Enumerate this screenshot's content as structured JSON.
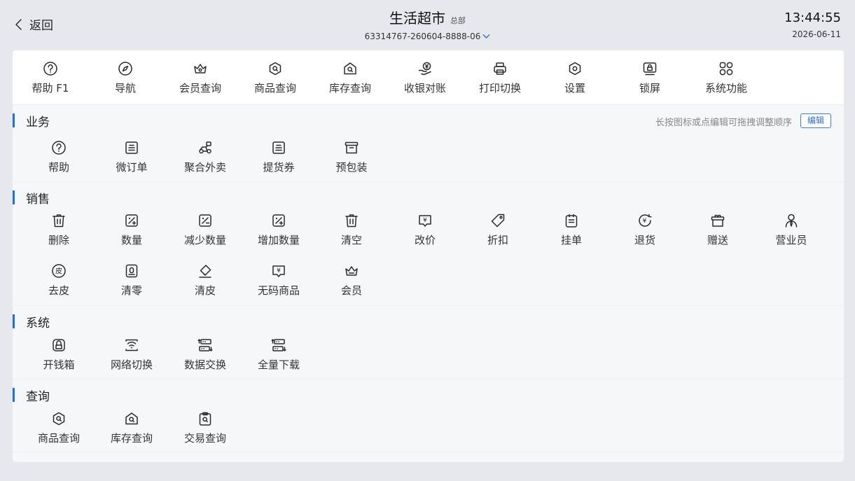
{
  "header": {
    "back_label": "返回",
    "store_name": "生活超市",
    "store_sub": "总部",
    "store_id": "63314767-260604-8888-06",
    "time": "13:44:55",
    "date": "2026-06-11"
  },
  "toolbar": {
    "items": [
      {
        "label": "帮助 F1",
        "icon": "help-icon"
      },
      {
        "label": "导航",
        "icon": "compass-icon"
      },
      {
        "label": "会员查询",
        "icon": "crown-icon"
      },
      {
        "label": "商品查询",
        "icon": "product-search-icon"
      },
      {
        "label": "库存查询",
        "icon": "inventory-search-icon"
      },
      {
        "label": "收银对账",
        "icon": "cash-reconcile-icon"
      },
      {
        "label": "打印切换",
        "icon": "printer-icon"
      },
      {
        "label": "设置",
        "icon": "settings-icon"
      },
      {
        "label": "锁屏",
        "icon": "lock-screen-icon"
      },
      {
        "label": "系统功能",
        "icon": "apps-grid-icon"
      }
    ]
  },
  "sections": {
    "business": {
      "title": "业务",
      "hint": "长按图标或点编辑可拖拽调整顺序",
      "edit_label": "编辑",
      "items": [
        {
          "label": "帮助",
          "icon": "help-icon"
        },
        {
          "label": "微订单",
          "icon": "order-icon"
        },
        {
          "label": "聚合外卖",
          "icon": "delivery-icon"
        },
        {
          "label": "提货券",
          "icon": "voucher-icon"
        },
        {
          "label": "预包装",
          "icon": "package-icon"
        }
      ]
    },
    "sales": {
      "title": "销售",
      "items": [
        {
          "label": "删除",
          "icon": "trash-icon"
        },
        {
          "label": "数量",
          "icon": "quantity-icon"
        },
        {
          "label": "减少数量",
          "icon": "decrease-quantity-icon"
        },
        {
          "label": "增加数量",
          "icon": "increase-quantity-icon"
        },
        {
          "label": "清空",
          "icon": "clear-icon"
        },
        {
          "label": "改价",
          "icon": "price-change-icon"
        },
        {
          "label": "折扣",
          "icon": "discount-tag-icon"
        },
        {
          "label": "挂单",
          "icon": "hold-order-icon"
        },
        {
          "label": "退货",
          "icon": "refund-icon"
        },
        {
          "label": "赠送",
          "icon": "gift-icon"
        },
        {
          "label": "营业员",
          "icon": "salesperson-icon"
        },
        {
          "label": "去皮",
          "icon": "tare-icon"
        },
        {
          "label": "清零",
          "icon": "zero-icon"
        },
        {
          "label": "清皮",
          "icon": "eraser-icon"
        },
        {
          "label": "无码商品",
          "icon": "no-barcode-icon"
        },
        {
          "label": "会员",
          "icon": "member-crown-icon"
        }
      ]
    },
    "system": {
      "title": "系统",
      "items": [
        {
          "label": "开钱箱",
          "icon": "cash-drawer-icon"
        },
        {
          "label": "网络切换",
          "icon": "network-switch-icon"
        },
        {
          "label": "数据交换",
          "icon": "data-exchange-icon"
        },
        {
          "label": "全量下载",
          "icon": "full-download-icon"
        }
      ]
    },
    "query": {
      "title": "查询",
      "items": [
        {
          "label": "商品查询",
          "icon": "product-search-icon"
        },
        {
          "label": "库存查询",
          "icon": "inventory-search-icon"
        },
        {
          "label": "交易查询",
          "icon": "transaction-search-icon"
        }
      ]
    }
  }
}
